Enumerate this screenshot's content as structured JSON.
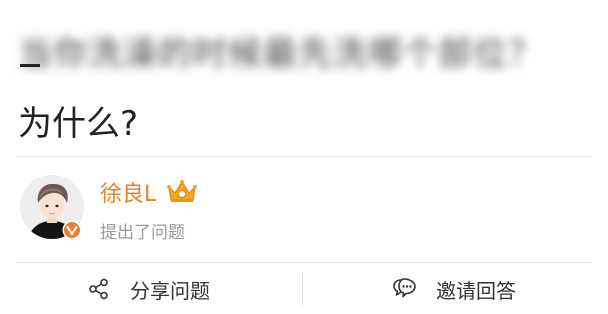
{
  "question": {
    "line1_blurred": "当你洗澡的时候最先洗哪个部位？",
    "line2": "为什么?"
  },
  "author": {
    "name": "徐良L",
    "action": "提出了问题",
    "badge_color": "#e8802a",
    "name_color": "#e8802a"
  },
  "actions": {
    "share_label": "分享问题",
    "invite_label": "邀请回答"
  },
  "icons": {
    "share": "share-icon",
    "invite": "chat-bubble-icon",
    "crown": "crown-icon",
    "verified": "verified-icon"
  }
}
